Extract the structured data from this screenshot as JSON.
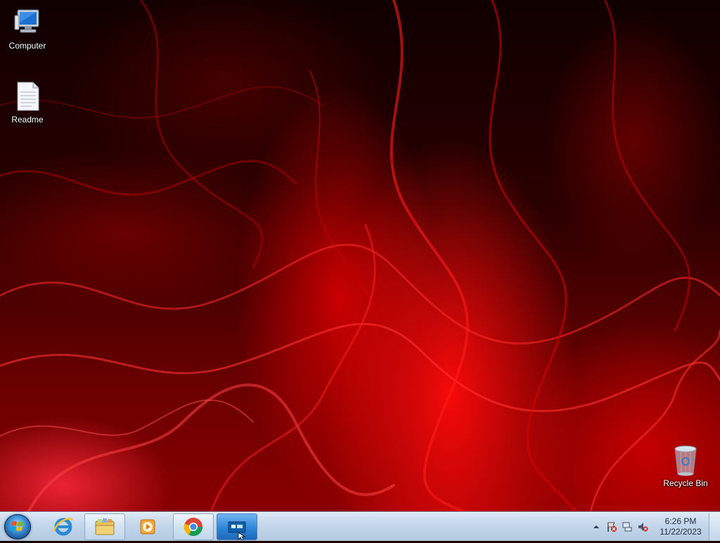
{
  "desktop": {
    "icons": [
      {
        "label": "Computer",
        "icon": "computer-icon"
      },
      {
        "label": "Readme",
        "icon": "text-document-icon"
      },
      {
        "label": "Recycle Bin",
        "icon": "recycle-bin-icon"
      }
    ],
    "wallpaper_colors": {
      "dark": "#100000",
      "mid": "#8a0000",
      "bright": "#ff1010"
    }
  },
  "taskbar": {
    "start_icon": "windows-start-orb-icon",
    "pinned": [
      {
        "name": "Internet Explorer",
        "icon": "internet-explorer-icon"
      },
      {
        "name": "Windows Explorer",
        "icon": "folder-library-icon"
      },
      {
        "name": "Windows Media Player",
        "icon": "media-player-icon"
      },
      {
        "name": "Google Chrome",
        "icon": "chrome-icon"
      },
      {
        "name": "Application window",
        "icon": "app-window-icon"
      }
    ],
    "tray": {
      "icons": [
        "show-hidden-icons-chevron",
        "action-center-flag-icon",
        "network-icon",
        "volume-muted-icon"
      ],
      "time": "6:26 PM",
      "date": "11/22/2023"
    }
  }
}
